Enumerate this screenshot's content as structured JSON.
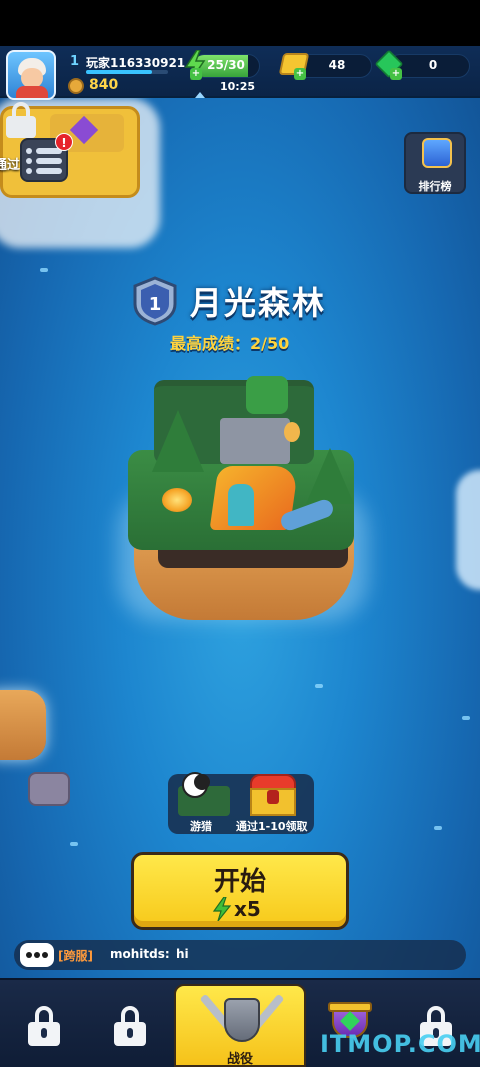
{
  "player": {
    "level": "1",
    "name": "玩家116330921",
    "xp_fraction": 0.8,
    "trophies": "840"
  },
  "resources": {
    "energy_text": "25/30",
    "energy_fraction": 0.83,
    "energy_timer": "10:25",
    "gold": "48",
    "gems": "0"
  },
  "left_island": {
    "pass_label": "通过"
  },
  "leaderboard": {
    "label": "排行榜"
  },
  "stage": {
    "level_number": "1",
    "title": "月光森林",
    "best_score": "最高成绩：2/50"
  },
  "rewards": {
    "hunt_label": "游猎",
    "chest_label": "通过1-10领取"
  },
  "start_button": {
    "label": "开始",
    "cost": "x5"
  },
  "chat": {
    "channel": "[跨服]",
    "user": "mohitds:",
    "message": "hi"
  },
  "nav": {
    "active_label": "战役"
  },
  "watermark": "ITMOP.COM",
  "colors": {
    "accent_yellow": "#f7c91a",
    "energy_green": "#37a33b",
    "ocean_blue": "#1d86cf"
  }
}
